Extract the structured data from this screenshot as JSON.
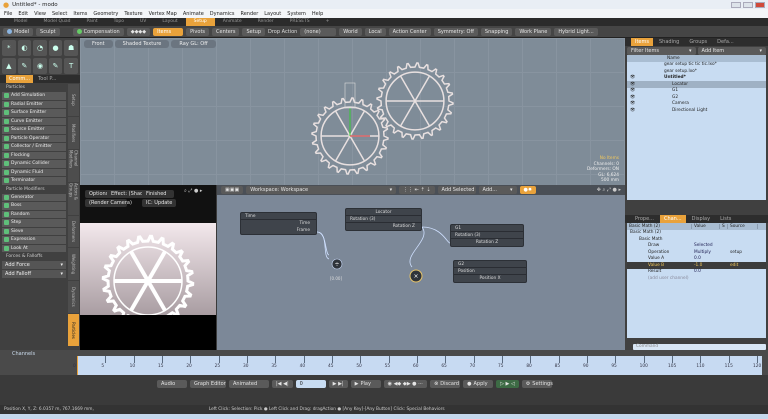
{
  "window": {
    "title": "Untitled* - modo"
  },
  "menu": [
    "File",
    "Edit",
    "View",
    "Select",
    "Items",
    "Geometry",
    "Texture",
    "Vertex Map",
    "Animate",
    "Dynamics",
    "Render",
    "Layout",
    "System",
    "Help"
  ],
  "layout_tabs": [
    {
      "label": "Model",
      "active": false
    },
    {
      "label": "Model Quad",
      "active": false
    },
    {
      "label": "Paint",
      "active": false
    },
    {
      "label": "Topo",
      "active": false
    },
    {
      "label": "UV",
      "active": false
    },
    {
      "label": "Layout",
      "active": false
    },
    {
      "label": "Setup",
      "active": true
    },
    {
      "label": "Animate",
      "active": false
    },
    {
      "label": "Render",
      "active": false
    },
    {
      "label": "PRESETS",
      "active": false
    },
    {
      "label": "+",
      "active": false
    }
  ],
  "toolbar": {
    "model": "Model",
    "sculpt": "Sculpt",
    "compensation": "Compensation",
    "items": "Items",
    "pivots": "Pivots",
    "centers": "Centers",
    "setup": "Setup",
    "drop_action_label": "Drop Action",
    "drop_action_value": "(none)",
    "world": "World",
    "local": "Local",
    "action_center": "Action Center",
    "symmetry": "Symmetry: Off",
    "snapping": "Snapping",
    "work_plane": "Work Plane",
    "hybrid_light": "Hybrid Light..."
  },
  "left_panel": {
    "tabs": [
      {
        "label": "Comm...",
        "active": true
      },
      {
        "label": "Tool P...",
        "active": false
      }
    ],
    "tool_icons": [
      "*",
      "◐",
      "◔",
      "●",
      "☗",
      "▲",
      "✎",
      "◉",
      "✎",
      "T"
    ],
    "sections": [
      {
        "title": "Particles",
        "items": [
          "Add Simulation",
          "Radial Emitter",
          "Surface Emitter",
          "Curve Emitter",
          "Source Emitter",
          "Particle Operator",
          "Collector / Emitter",
          "Flocking",
          "Dynamic Collider",
          "Dynamic Fluid",
          "Terminator"
        ]
      },
      {
        "title": "Particle Modifiers",
        "items": [
          "Generator",
          "Boss",
          "Random",
          "Step",
          "Sieve",
          "Expression",
          "Look At"
        ]
      },
      {
        "title": "Forces & Falloffs",
        "dropdowns": [
          "Add Force",
          "Add Falloff"
        ]
      }
    ],
    "vertical_tabs": [
      {
        "label": "Setup",
        "active": false
      },
      {
        "label": "Modifiers",
        "active": false
      },
      {
        "label": "Channel Modifiers",
        "active": false
      },
      {
        "label": "Actors & Groups",
        "active": false
      },
      {
        "label": "Deformers",
        "active": false
      },
      {
        "label": "Weighting",
        "active": false
      },
      {
        "label": "Dynamics",
        "active": false
      },
      {
        "label": "Particles",
        "active": true
      }
    ]
  },
  "viewport": {
    "buttons": [
      "Front",
      "Shaded Texture",
      "Ray GL: Off"
    ],
    "info": {
      "selection": "No Items",
      "channels": "Channels: 0",
      "deformers": "Deformers: ON",
      "gl": "GL: 6,624",
      "scale": "500 mm"
    }
  },
  "preview": {
    "options": "Options",
    "effect": "Effect: (Shadi...",
    "status": "Finished",
    "camera": "(Render Camera)",
    "update": "IC: Update"
  },
  "schematic": {
    "workspace": "Workspace: Workspace",
    "add_selected": "Add Selected",
    "add": "Add...",
    "nodes": [
      {
        "id": "time",
        "title": "Time",
        "rows": [
          "Time",
          "Frame"
        ]
      },
      {
        "id": "locator",
        "title": "Locator",
        "sub": "Rotation (3)",
        "rows": [
          "Rotation Z"
        ]
      },
      {
        "id": "g1",
        "title": "G1",
        "sub": "Rotation (3)",
        "rows": [
          "Rotation Z"
        ]
      },
      {
        "id": "g2",
        "title": "G2",
        "sub": "Position",
        "rows": [
          "Position X"
        ]
      }
    ],
    "op_labels": [
      "÷",
      "×"
    ],
    "op_caption": "[0.00]"
  },
  "items_panel": {
    "tabs": [
      {
        "label": "Items",
        "active": true
      },
      {
        "label": "Shading",
        "active": false
      },
      {
        "label": "Groups",
        "active": false
      },
      {
        "label": "Defa...",
        "active": false
      }
    ],
    "filter": "Filter Items",
    "add_item": "Add Item",
    "column": "Name",
    "rows": [
      {
        "name": "gear setup tic tic tic.lxo*",
        "indent": 1,
        "eye": false,
        "sel": false
      },
      {
        "name": "gear setup.lxo*",
        "indent": 1,
        "eye": false,
        "sel": false
      },
      {
        "name": "Untitled*",
        "indent": 1,
        "eye": true,
        "sel": false
      },
      {
        "name": "Locator",
        "indent": 2,
        "eye": true,
        "sel": true
      },
      {
        "name": "G1",
        "indent": 2,
        "eye": true,
        "sel": false
      },
      {
        "name": "G2",
        "indent": 2,
        "eye": true,
        "sel": false
      },
      {
        "name": "Camera",
        "indent": 2,
        "eye": true,
        "sel": false
      },
      {
        "name": "Directional Light",
        "indent": 2,
        "eye": true,
        "sel": false
      }
    ]
  },
  "channels_panel": {
    "tabs": [
      {
        "label": "Prope...",
        "active": false
      },
      {
        "label": "Chan...",
        "active": true
      },
      {
        "label": "Display",
        "active": false
      },
      {
        "label": "Lists",
        "active": false
      }
    ],
    "columns": [
      "Basic Math (2)",
      "Value",
      "S",
      "Source"
    ],
    "rows": [
      {
        "name": "Basic Math (2)",
        "value": "",
        "source": "",
        "indent": 0
      },
      {
        "name": "Basic Math",
        "value": "",
        "source": "",
        "indent": 1
      },
      {
        "name": "Draw",
        "value": "Selected",
        "source": "",
        "indent": 2
      },
      {
        "name": "Operation",
        "value": "Multiply",
        "source": "setup",
        "indent": 2
      },
      {
        "name": "Value A",
        "value": "0.0",
        "source": "",
        "indent": 2
      },
      {
        "name": "Value B",
        "value": "-1.0",
        "source": "edit",
        "indent": 2,
        "active": true
      },
      {
        "name": "Result",
        "value": "0.0",
        "source": "",
        "indent": 2
      },
      {
        "name": "(add user channel)",
        "value": "",
        "source": "",
        "indent": 2
      }
    ],
    "command_placeholder": "Command"
  },
  "timeline": {
    "channels_label": "Channels",
    "ticks": [
      0,
      5,
      10,
      15,
      20,
      25,
      30,
      35,
      40,
      45,
      50,
      55,
      60,
      65,
      70,
      75,
      80,
      85,
      90,
      95,
      100,
      105,
      110,
      115,
      120
    ],
    "current_frame": 0,
    "end_label": "120"
  },
  "transport": {
    "audio": "Audio",
    "graph_editor": "Graph Editor",
    "animated": "Animated",
    "frame": "0",
    "play": "Play",
    "discard": "Discard",
    "apply": "Apply",
    "settings": "Settings"
  },
  "status": {
    "position": "Position X, Y, Z:  6.0357 m, 767.1669 mm,",
    "hint": "Left Click: Selection: Pick ● Left Click and Drag: dragAction ● [Any Key]-[Any Button] Click: Special Behaviors"
  },
  "colors": {
    "accent": "#e9a23b",
    "viewport": "#7f8c98",
    "schematic": "#7c8898",
    "list": "#c8dcf2"
  }
}
